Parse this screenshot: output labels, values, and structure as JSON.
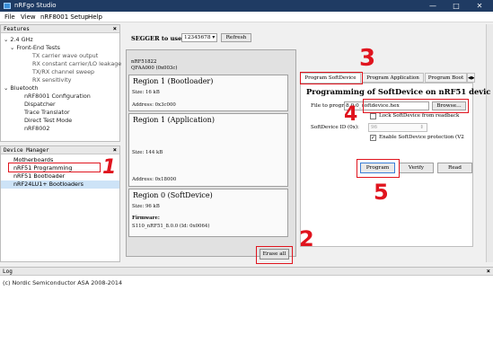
{
  "window": {
    "title": "nRFgo Studio",
    "minimize": "—",
    "maximize": "□",
    "close": "✕"
  },
  "menu": {
    "file": "File",
    "view": "View",
    "setup": "nRF8001 Setup",
    "help": "Help"
  },
  "features_panel": {
    "title": "Features",
    "close": "×",
    "tree": [
      "2.4 GHz",
      "Front-End Tests",
      "TX carrier wave output",
      "RX constant carrier/LO leakage",
      "TX/RX channel sweep",
      "RX sensitivity",
      "Bluetooth",
      "nRF8001 Configuration",
      "Dispatcher",
      "Trace Translator",
      "Direct Test Mode",
      "nRF8002"
    ]
  },
  "device_manager": {
    "title": "Device Manager",
    "close": "×",
    "items": [
      "Motherboards",
      "nRF51 Programming",
      "nRF51 Bootloader",
      "nRF24LU1+ Bootloaders"
    ]
  },
  "segger": {
    "label": "SEGGER to use:",
    "selected": "12345678",
    "refresh": "Refresh"
  },
  "device_info": {
    "line1": "nRF51822",
    "line2": "QFAA000 (0x003c)"
  },
  "regions": [
    {
      "title": "Region 1 (Bootloader)",
      "size": "Size:  16 kB",
      "address": "Address:  0x3c000"
    },
    {
      "title": "Region 1 (Application)",
      "size": "Size:  144 kB",
      "address": "Address:  0x18000"
    },
    {
      "title": "Region 0 (SoftDevice)",
      "size": "Size:  96 kB",
      "firmware_label": "Firmware:",
      "firmware": "S110_nRF51_8.0.0 (Id: 0x0064)"
    }
  ],
  "erase_all": "Erase all",
  "tabs": [
    "Program SoftDevice",
    "Program Application",
    "Program Boot"
  ],
  "tab_scroll": "◀▶",
  "program_panel": {
    "heading": "Programming of SoftDevice on nRF51 devic",
    "file_label": "File to program:",
    "file_value": "8.0.0_softdevice.hex",
    "browse": "Browse...",
    "lock_label": "Lock SoftDevice from readback",
    "sd_id_label": "SoftDevice ID (0x):",
    "sd_id_value": "96",
    "enable_protection": "Enable SoftDevice protection (V2",
    "program": "Program",
    "verify": "Verify",
    "read": "Read"
  },
  "log": {
    "title": "Log",
    "close": "×",
    "text": "(c) Nordic Semiconductor ASA 2008-2014"
  },
  "annotations": [
    "1",
    "2",
    "3",
    "4",
    "5"
  ],
  "colors": {
    "annotation": "#e0141e",
    "titlebar": "#1f3b63",
    "selection": "#cde3f7"
  }
}
